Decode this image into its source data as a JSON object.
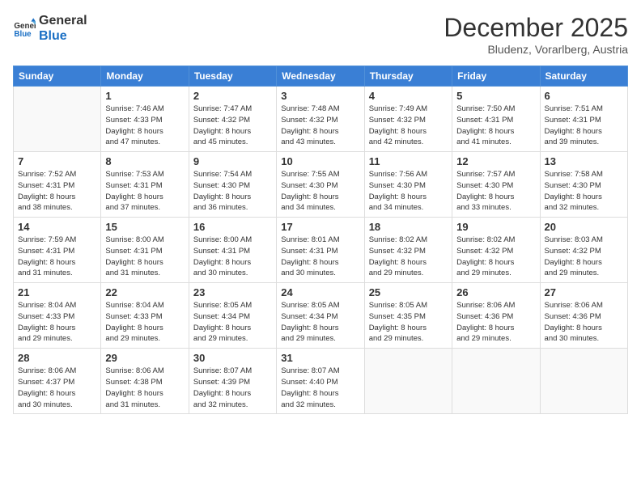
{
  "logo": {
    "line1": "General",
    "line2": "Blue"
  },
  "title": "December 2025",
  "subtitle": "Bludenz, Vorarlberg, Austria",
  "weekdays": [
    "Sunday",
    "Monday",
    "Tuesday",
    "Wednesday",
    "Thursday",
    "Friday",
    "Saturday"
  ],
  "weeks": [
    [
      {
        "day": "",
        "info": ""
      },
      {
        "day": "1",
        "info": "Sunrise: 7:46 AM\nSunset: 4:33 PM\nDaylight: 8 hours\nand 47 minutes."
      },
      {
        "day": "2",
        "info": "Sunrise: 7:47 AM\nSunset: 4:32 PM\nDaylight: 8 hours\nand 45 minutes."
      },
      {
        "day": "3",
        "info": "Sunrise: 7:48 AM\nSunset: 4:32 PM\nDaylight: 8 hours\nand 43 minutes."
      },
      {
        "day": "4",
        "info": "Sunrise: 7:49 AM\nSunset: 4:32 PM\nDaylight: 8 hours\nand 42 minutes."
      },
      {
        "day": "5",
        "info": "Sunrise: 7:50 AM\nSunset: 4:31 PM\nDaylight: 8 hours\nand 41 minutes."
      },
      {
        "day": "6",
        "info": "Sunrise: 7:51 AM\nSunset: 4:31 PM\nDaylight: 8 hours\nand 39 minutes."
      }
    ],
    [
      {
        "day": "7",
        "info": "Sunrise: 7:52 AM\nSunset: 4:31 PM\nDaylight: 8 hours\nand 38 minutes."
      },
      {
        "day": "8",
        "info": "Sunrise: 7:53 AM\nSunset: 4:31 PM\nDaylight: 8 hours\nand 37 minutes."
      },
      {
        "day": "9",
        "info": "Sunrise: 7:54 AM\nSunset: 4:30 PM\nDaylight: 8 hours\nand 36 minutes."
      },
      {
        "day": "10",
        "info": "Sunrise: 7:55 AM\nSunset: 4:30 PM\nDaylight: 8 hours\nand 34 minutes."
      },
      {
        "day": "11",
        "info": "Sunrise: 7:56 AM\nSunset: 4:30 PM\nDaylight: 8 hours\nand 34 minutes."
      },
      {
        "day": "12",
        "info": "Sunrise: 7:57 AM\nSunset: 4:30 PM\nDaylight: 8 hours\nand 33 minutes."
      },
      {
        "day": "13",
        "info": "Sunrise: 7:58 AM\nSunset: 4:30 PM\nDaylight: 8 hours\nand 32 minutes."
      }
    ],
    [
      {
        "day": "14",
        "info": "Sunrise: 7:59 AM\nSunset: 4:31 PM\nDaylight: 8 hours\nand 31 minutes."
      },
      {
        "day": "15",
        "info": "Sunrise: 8:00 AM\nSunset: 4:31 PM\nDaylight: 8 hours\nand 31 minutes."
      },
      {
        "day": "16",
        "info": "Sunrise: 8:00 AM\nSunset: 4:31 PM\nDaylight: 8 hours\nand 30 minutes."
      },
      {
        "day": "17",
        "info": "Sunrise: 8:01 AM\nSunset: 4:31 PM\nDaylight: 8 hours\nand 30 minutes."
      },
      {
        "day": "18",
        "info": "Sunrise: 8:02 AM\nSunset: 4:32 PM\nDaylight: 8 hours\nand 29 minutes."
      },
      {
        "day": "19",
        "info": "Sunrise: 8:02 AM\nSunset: 4:32 PM\nDaylight: 8 hours\nand 29 minutes."
      },
      {
        "day": "20",
        "info": "Sunrise: 8:03 AM\nSunset: 4:32 PM\nDaylight: 8 hours\nand 29 minutes."
      }
    ],
    [
      {
        "day": "21",
        "info": "Sunrise: 8:04 AM\nSunset: 4:33 PM\nDaylight: 8 hours\nand 29 minutes."
      },
      {
        "day": "22",
        "info": "Sunrise: 8:04 AM\nSunset: 4:33 PM\nDaylight: 8 hours\nand 29 minutes."
      },
      {
        "day": "23",
        "info": "Sunrise: 8:05 AM\nSunset: 4:34 PM\nDaylight: 8 hours\nand 29 minutes."
      },
      {
        "day": "24",
        "info": "Sunrise: 8:05 AM\nSunset: 4:34 PM\nDaylight: 8 hours\nand 29 minutes."
      },
      {
        "day": "25",
        "info": "Sunrise: 8:05 AM\nSunset: 4:35 PM\nDaylight: 8 hours\nand 29 minutes."
      },
      {
        "day": "26",
        "info": "Sunrise: 8:06 AM\nSunset: 4:36 PM\nDaylight: 8 hours\nand 29 minutes."
      },
      {
        "day": "27",
        "info": "Sunrise: 8:06 AM\nSunset: 4:36 PM\nDaylight: 8 hours\nand 30 minutes."
      }
    ],
    [
      {
        "day": "28",
        "info": "Sunrise: 8:06 AM\nSunset: 4:37 PM\nDaylight: 8 hours\nand 30 minutes."
      },
      {
        "day": "29",
        "info": "Sunrise: 8:06 AM\nSunset: 4:38 PM\nDaylight: 8 hours\nand 31 minutes."
      },
      {
        "day": "30",
        "info": "Sunrise: 8:07 AM\nSunset: 4:39 PM\nDaylight: 8 hours\nand 32 minutes."
      },
      {
        "day": "31",
        "info": "Sunrise: 8:07 AM\nSunset: 4:40 PM\nDaylight: 8 hours\nand 32 minutes."
      },
      {
        "day": "",
        "info": ""
      },
      {
        "day": "",
        "info": ""
      },
      {
        "day": "",
        "info": ""
      }
    ]
  ]
}
